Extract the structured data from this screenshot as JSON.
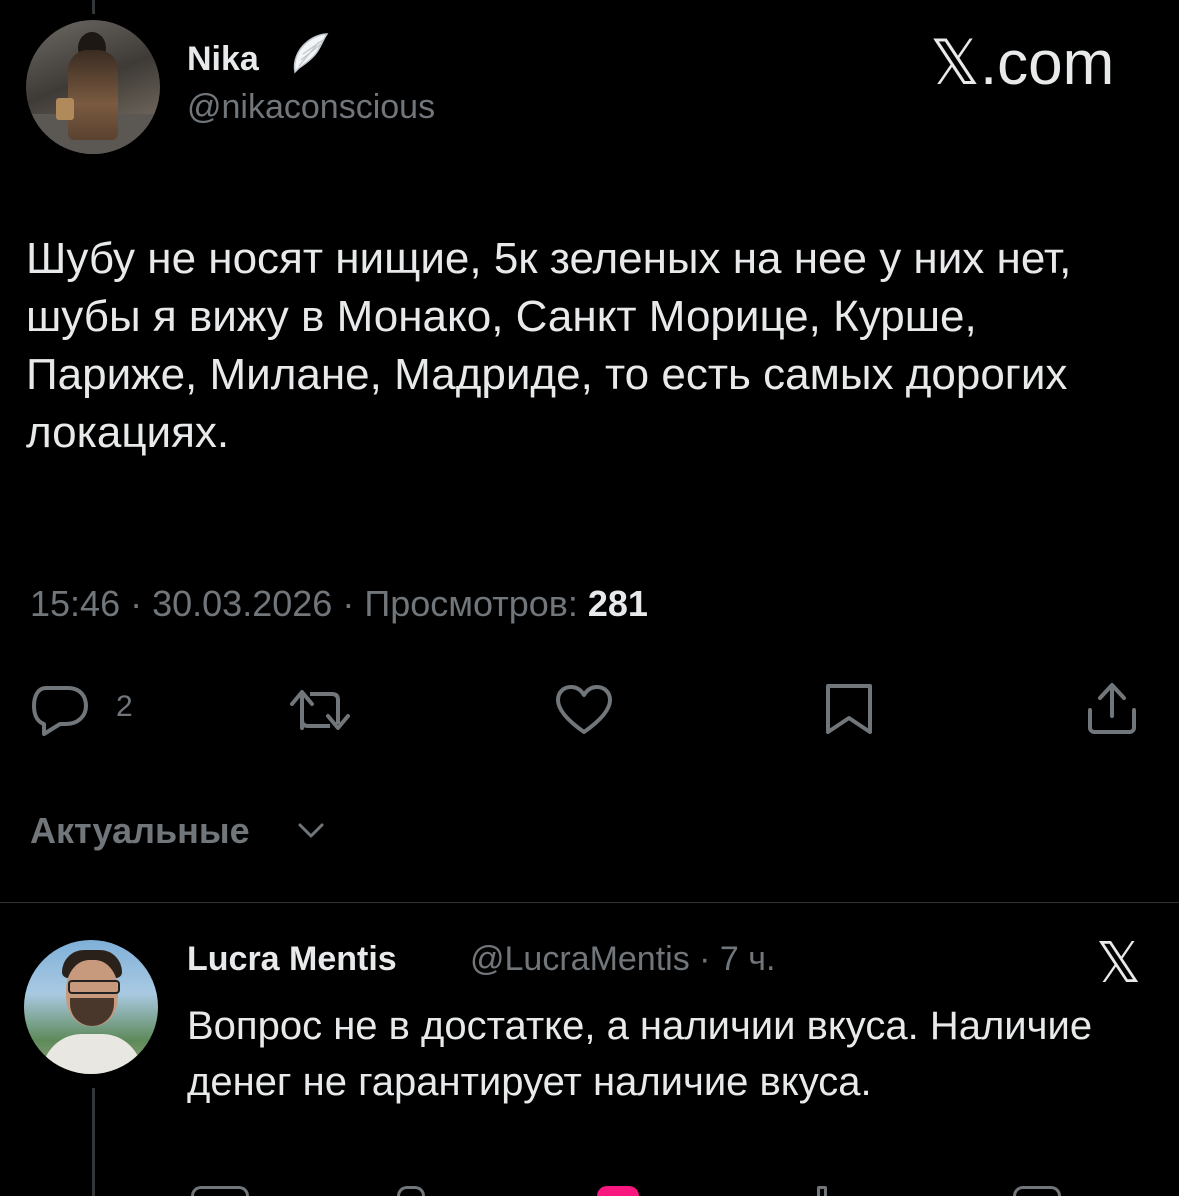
{
  "tweet": {
    "author_name": "Nika",
    "author_handle": "@nikaconscious",
    "site_label": "𝕏.com",
    "text": "Шубу не носят нищие, 5к зеленых на нее у них нет, шубы я вижу в Монако, Санкт Морице, Курше, Париже, Милане, Мадриде, то есть самых дорогих локациях.",
    "time": "15:46",
    "date": "30.03.2026",
    "views_label": "Просмотров:",
    "views_count": "281",
    "reply_count": "2"
  },
  "sort": {
    "label": "Актуальные"
  },
  "reply": {
    "author_name": "Lucra Mentis",
    "author_handle": "@LucraMentis · 7 ч.",
    "site_label": "𝕏",
    "text": "Вопрос не в достатке, а наличии вкуса. Наличие денег не гарантирует наличие вкуса."
  },
  "icons": {
    "reply": "reply-icon",
    "retweet": "retweet-icon",
    "like": "heart-icon",
    "bookmark": "bookmark-icon",
    "share": "share-icon",
    "sort": "chevron-down-icon",
    "badge": "wing-icon"
  },
  "colors": {
    "background": "#000000",
    "text_primary": "#e7e9ea",
    "text_secondary": "#71767b",
    "divider": "#2f3336"
  }
}
